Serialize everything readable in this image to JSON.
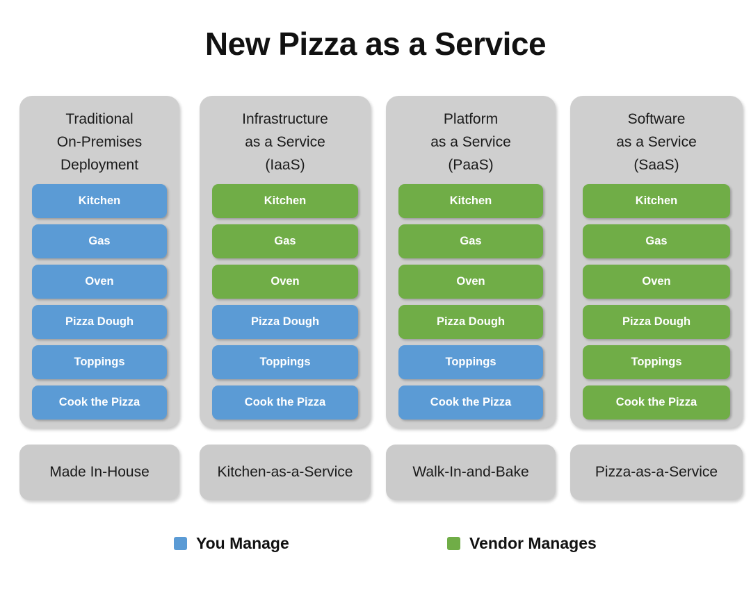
{
  "title": "New Pizza as a Service",
  "colors": {
    "you_manage": "#5b9bd5",
    "vendor_manages": "#70ad47",
    "panel_grey": "#cfcfcf",
    "footer_grey": "#cbcbcb",
    "title_text": "#111111"
  },
  "columns": [
    {
      "header_lines": [
        "Traditional",
        "On-Premises",
        "Deployment"
      ],
      "footer": "Made In-House",
      "items": [
        {
          "label": "Kitchen",
          "managed_by": "you"
        },
        {
          "label": "Gas",
          "managed_by": "you"
        },
        {
          "label": "Oven",
          "managed_by": "you"
        },
        {
          "label": "Pizza Dough",
          "managed_by": "you"
        },
        {
          "label": "Toppings",
          "managed_by": "you"
        },
        {
          "label": "Cook the Pizza",
          "managed_by": "you"
        }
      ]
    },
    {
      "header_lines": [
        "Infrastructure",
        "as a Service",
        "(IaaS)"
      ],
      "footer": "Kitchen-as-a-Service",
      "items": [
        {
          "label": "Kitchen",
          "managed_by": "vendor"
        },
        {
          "label": "Gas",
          "managed_by": "vendor"
        },
        {
          "label": "Oven",
          "managed_by": "vendor"
        },
        {
          "label": "Pizza Dough",
          "managed_by": "you"
        },
        {
          "label": "Toppings",
          "managed_by": "you"
        },
        {
          "label": "Cook the Pizza",
          "managed_by": "you"
        }
      ]
    },
    {
      "header_lines": [
        "Platform",
        "as a Service",
        "(PaaS)"
      ],
      "footer": "Walk-In-and-Bake",
      "items": [
        {
          "label": "Kitchen",
          "managed_by": "vendor"
        },
        {
          "label": "Gas",
          "managed_by": "vendor"
        },
        {
          "label": "Oven",
          "managed_by": "vendor"
        },
        {
          "label": "Pizza Dough",
          "managed_by": "vendor"
        },
        {
          "label": "Toppings",
          "managed_by": "you"
        },
        {
          "label": "Cook the Pizza",
          "managed_by": "you"
        }
      ]
    },
    {
      "header_lines": [
        "Software",
        "as a Service",
        "(SaaS)"
      ],
      "footer": "Pizza-as-a-Service",
      "items": [
        {
          "label": "Kitchen",
          "managed_by": "vendor"
        },
        {
          "label": "Gas",
          "managed_by": "vendor"
        },
        {
          "label": "Oven",
          "managed_by": "vendor"
        },
        {
          "label": "Pizza Dough",
          "managed_by": "vendor"
        },
        {
          "label": "Toppings",
          "managed_by": "vendor"
        },
        {
          "label": "Cook the Pizza",
          "managed_by": "vendor"
        }
      ]
    }
  ],
  "legend": [
    {
      "label": "You Manage",
      "color": "#5b9bd5",
      "swatch_name": "legend-swatch-you-manage"
    },
    {
      "label": "Vendor Manages",
      "color": "#70ad47",
      "swatch_name": "legend-swatch-vendor-manages"
    }
  ]
}
